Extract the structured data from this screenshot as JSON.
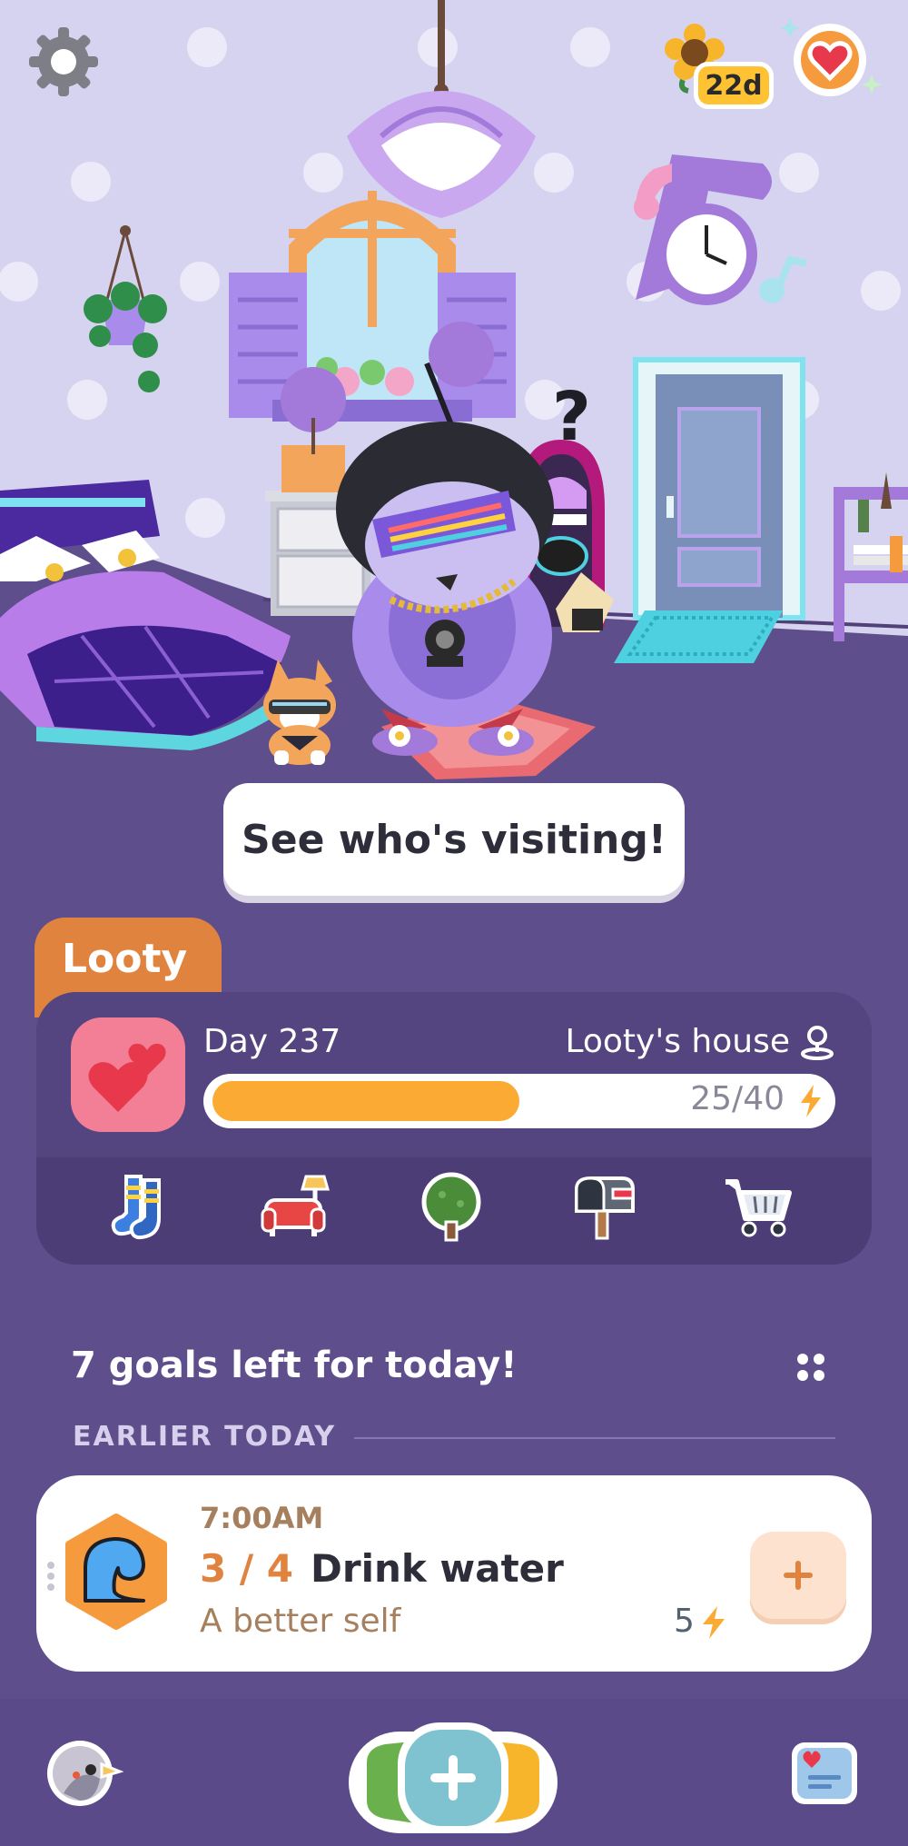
{
  "header": {
    "settings_icon": "gear-icon",
    "streak_days": "22d",
    "streak_icon": "sunflower-icon",
    "support_icon": "heart-icon"
  },
  "scene": {
    "visit_button_label": "See who's visiting!",
    "question_mark": "?"
  },
  "pet": {
    "name": "Looty",
    "day_label": "Day 237",
    "house_label": "Looty's house",
    "energy_current": 25,
    "energy_goal": 40,
    "energy_text": "25/40",
    "shortcuts": [
      {
        "name": "socks-icon",
        "label": "Socks"
      },
      {
        "name": "sofa-icon",
        "label": "Furniture"
      },
      {
        "name": "tree-icon",
        "label": "Outdoors"
      },
      {
        "name": "mailbox-icon",
        "label": "Mail"
      },
      {
        "name": "cart-icon",
        "label": "Shop"
      }
    ]
  },
  "goals": {
    "title": "7 goals left for today!",
    "section_label": "EARLIER TODAY",
    "items": [
      {
        "time": "7:00AM",
        "progress": "3 / 4",
        "name": "Drink water",
        "category": "A better self",
        "energy": "5",
        "icon": "water-wave-icon"
      }
    ]
  },
  "nav": {
    "profile_icon": "bird-avatar-icon",
    "add_icon": "plus-icon",
    "journal_icon": "journal-icon"
  },
  "colors": {
    "background": "#5f4e8c",
    "card": "#4d3d77",
    "accent_orange": "#e0833f",
    "energy_yellow": "#fbaa33",
    "teal": "#7ec3cf",
    "pink": "#f37f96"
  }
}
